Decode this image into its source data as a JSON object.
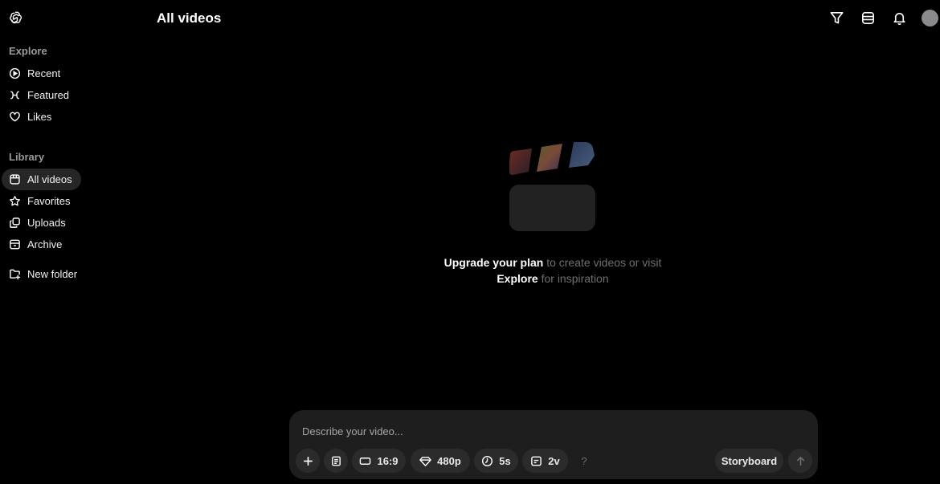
{
  "header": {
    "title": "All videos"
  },
  "sidebar": {
    "explore_label": "Explore",
    "explore_items": [
      {
        "label": "Recent",
        "icon": "play-circle-icon"
      },
      {
        "label": "Featured",
        "icon": "featured-icon"
      },
      {
        "label": "Likes",
        "icon": "heart-icon"
      }
    ],
    "library_label": "Library",
    "library_items": [
      {
        "label": "All videos",
        "icon": "grid-icon",
        "active": true
      },
      {
        "label": "Favorites",
        "icon": "star-icon"
      },
      {
        "label": "Uploads",
        "icon": "uploads-icon"
      },
      {
        "label": "Archive",
        "icon": "archive-icon"
      }
    ],
    "new_folder_label": "New folder"
  },
  "empty_state": {
    "upgrade_link": "Upgrade your plan",
    "text_1": " to create videos or visit ",
    "explore_link": "Explore",
    "text_2": " for inspiration"
  },
  "composer": {
    "placeholder": "Describe your video...",
    "aspect_ratio": "16:9",
    "resolution": "480p",
    "duration": "5s",
    "variations": "2v",
    "help": "?",
    "storyboard_label": "Storyboard"
  },
  "colors": {
    "background": "#000000",
    "surface": "#1e1e1e",
    "pill": "#2b2b2b",
    "active_nav": "#262626",
    "muted_text": "#6f6f6f"
  }
}
